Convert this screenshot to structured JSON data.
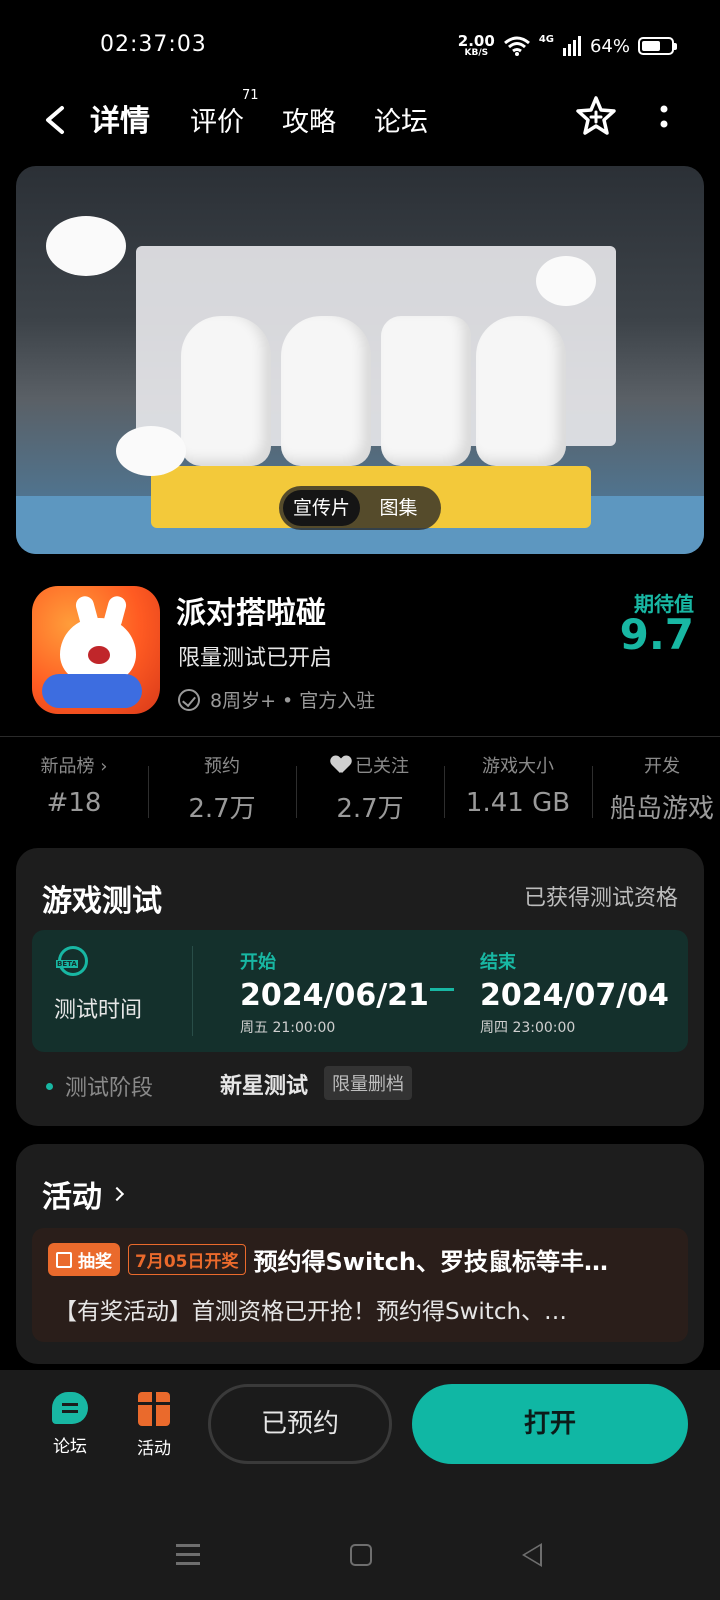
{
  "status_bar": {
    "time": "02:37:03",
    "net_speed_value": "2.00",
    "net_speed_unit": "KB/S",
    "signal_label": "4G",
    "battery": "64%",
    "battery_level": 0.64
  },
  "nav": {
    "tabs": [
      {
        "label": "详情",
        "active": true
      },
      {
        "label": "评价",
        "badge": "71"
      },
      {
        "label": "攻略"
      },
      {
        "label": "论坛"
      }
    ]
  },
  "banner": {
    "options": [
      "宣传片",
      "图集"
    ],
    "selected": "宣传片"
  },
  "app": {
    "name": "派对搭啦碰",
    "subtitle": "限量测试已开启",
    "meta": "8周岁+ • 官方入驻",
    "score_label": "期待值",
    "score": "9.7"
  },
  "stats": [
    {
      "label": "新品榜 ›",
      "value": "#18"
    },
    {
      "label": "预约",
      "value": "2.7万"
    },
    {
      "label": "已关注",
      "value": "2.7万"
    },
    {
      "label": "游戏大小",
      "value": "1.41 GB"
    },
    {
      "label": "开发",
      "value": "船岛游戏"
    }
  ],
  "test": {
    "title": "游戏测试",
    "status": "已获得测试资格",
    "time_label": "测试时间",
    "start_label": "开始",
    "start_date": "2024/06/21",
    "start_time": "周五  21:00:00",
    "end_label": "结束",
    "end_date": "2024/07/04",
    "end_time": "周四  23:00:00",
    "phase_label": "测试阶段",
    "phase_value": "新星测试",
    "phase_tag": "限量删档"
  },
  "activity": {
    "title": "活动",
    "tag": "抽奖",
    "date_tag": "7月05日开奖",
    "headline": "预约得Switch、罗技鼠标等丰…",
    "desc": "【有奖活动】首测资格已开抢！预约得Switch、…"
  },
  "bottom": {
    "forum_label": "论坛",
    "activity_label": "活动",
    "reserved_label": "已预约",
    "open_label": "打开"
  },
  "colors": {
    "accent": "#18b7a3",
    "orange": "#ea6a2c"
  }
}
